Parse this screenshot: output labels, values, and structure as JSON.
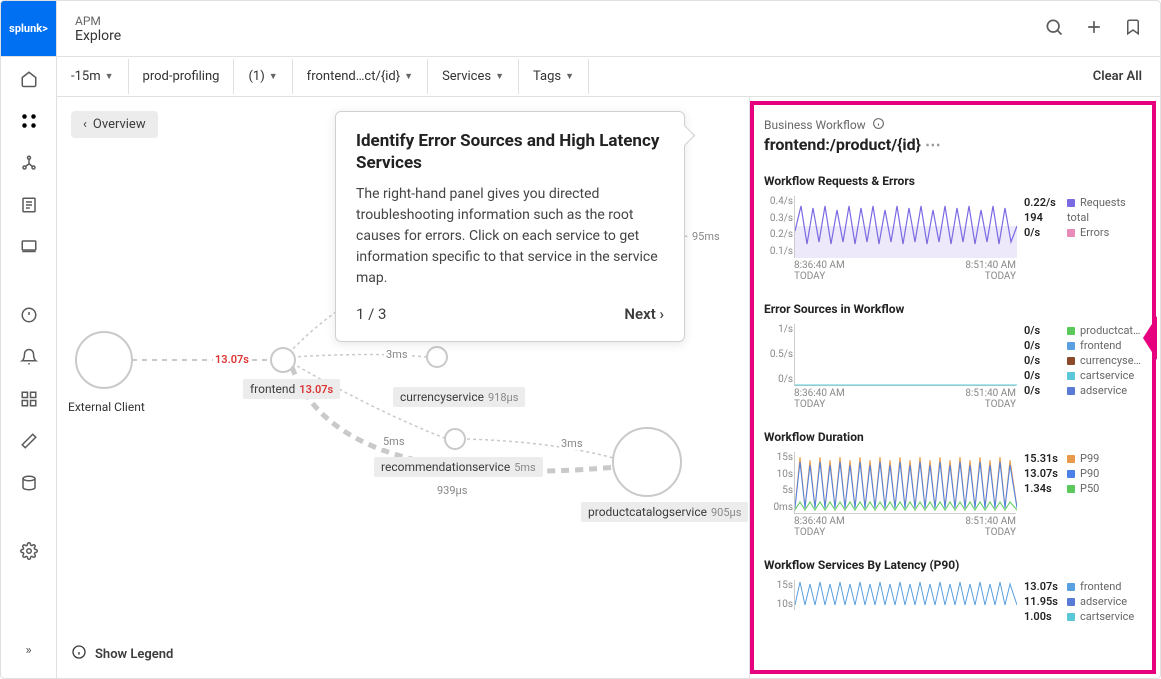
{
  "header": {
    "apm": "APM",
    "title": "Explore"
  },
  "filters": {
    "timerange": "-15m",
    "env": "prod-profiling",
    "count": "(1)",
    "workflow": "frontend…ct/{id}",
    "services": "Services",
    "tags": "Tags",
    "clear": "Clear All"
  },
  "canvas": {
    "overview": "Overview",
    "legend": "Show Legend",
    "externalClient": "External Client",
    "nodes": {
      "frontend": {
        "name": "frontend",
        "latency": "13.07s"
      },
      "currency": {
        "name": "currencyservice",
        "latency": "918µs"
      },
      "recommendation": {
        "name": "recommendationservice",
        "latency": "5ms"
      },
      "productcatalog": {
        "name": "productcatalogservice",
        "latency": "905µs"
      }
    },
    "edges": {
      "ext_front": "13.07s",
      "front_curr": "3ms",
      "front_rec": "5ms",
      "rec_prod": "3ms",
      "front_prod": "939µs",
      "front_top": "95ms"
    }
  },
  "popup": {
    "title": "Identify Error Sources and High Latency Services",
    "body": "The right-hand panel gives you directed troubleshooting information such as the root causes for errors. Click on each service to get information specific to that service in the service map.",
    "step": "1 / 3",
    "next": "Next ›"
  },
  "panel": {
    "label": "Business Workflow",
    "title": "frontend:/product/{id}",
    "sections": {
      "requests": {
        "title": "Workflow Requests & Errors",
        "yticks": [
          "0.4/s",
          "0.3/s",
          "0.2/s",
          "0.1/s"
        ],
        "xstart": {
          "time": "8:36:40 AM",
          "day": "TODAY"
        },
        "xend": {
          "time": "8:51:40 AM",
          "day": "TODAY"
        },
        "legend": [
          {
            "val": "0.22/s",
            "name": "Requests",
            "color": "#7b6be3"
          },
          {
            "val": "194",
            "name": "total",
            "color": ""
          },
          {
            "val": "0/s",
            "name": "Errors",
            "color": "#e88bb8"
          }
        ]
      },
      "errorsrc": {
        "title": "Error Sources in Workflow",
        "yticks": [
          "1/s",
          "0.5/s",
          "0/s"
        ],
        "xstart": {
          "time": "8:36:40 AM",
          "day": "TODAY"
        },
        "xend": {
          "time": "8:51:40 AM",
          "day": "TODAY"
        },
        "legend": [
          {
            "val": "0/s",
            "name": "productcat…",
            "color": "#5ac85a"
          },
          {
            "val": "0/s",
            "name": "frontend",
            "color": "#5aa0e0"
          },
          {
            "val": "0/s",
            "name": "currencyse…",
            "color": "#8b4a2a"
          },
          {
            "val": "0/s",
            "name": "cartservice",
            "color": "#5ac8d8"
          },
          {
            "val": "0/s",
            "name": "adservice",
            "color": "#5a7ad8"
          }
        ]
      },
      "duration": {
        "title": "Workflow Duration",
        "yticks": [
          "15s",
          "10s",
          "5s",
          "0ms"
        ],
        "xstart": {
          "time": "8:36:40 AM",
          "day": "TODAY"
        },
        "xend": {
          "time": "8:51:40 AM",
          "day": "TODAY"
        },
        "legend": [
          {
            "val": "15.31s",
            "name": "P99",
            "color": "#e89a4a"
          },
          {
            "val": "13.07s",
            "name": "P90",
            "color": "#4a80e8"
          },
          {
            "val": "1.34s",
            "name": "P50",
            "color": "#5ac85a"
          }
        ]
      },
      "latency": {
        "title": "Workflow Services By Latency (P90)",
        "yticks": [
          "15s",
          "10s"
        ],
        "legend": [
          {
            "val": "13.07s",
            "name": "frontend",
            "color": "#5aa0e0"
          },
          {
            "val": "11.95s",
            "name": "adservice",
            "color": "#5a7ad8"
          },
          {
            "val": "1.00s",
            "name": "cartservice",
            "color": "#5ac8d8"
          }
        ]
      }
    }
  }
}
